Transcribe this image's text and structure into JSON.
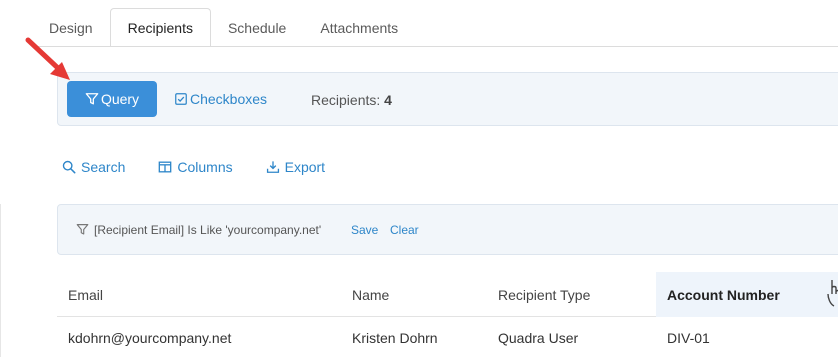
{
  "tabs": [
    {
      "label": "Design",
      "active": false
    },
    {
      "label": "Recipients",
      "active": true
    },
    {
      "label": "Schedule",
      "active": false
    },
    {
      "label": "Attachments",
      "active": false
    }
  ],
  "toolbar": {
    "query_label": "Query",
    "checkboxes_label": "Checkboxes",
    "recipients_label": "Recipients:",
    "recipients_count": "4"
  },
  "actions": {
    "search": "Search",
    "columns": "Columns",
    "export": "Export"
  },
  "filter": {
    "text": "[Recipient Email] Is Like 'yourcompany.net'",
    "save": "Save",
    "clear": "Clear"
  },
  "table": {
    "columns": [
      "Email",
      "Name",
      "Recipient Type",
      "Account Number"
    ],
    "sorted_column": "Account Number",
    "rows": [
      [
        "kdohrn@yourcompany.net",
        "Kristen Dohrn",
        "Quadra User",
        "DIV-01"
      ]
    ]
  },
  "colors": {
    "accent": "#3b8fd9",
    "link": "#2e86c9",
    "annotation_arrow": "#e53935",
    "panel_bg": "#f2f6fa"
  },
  "icons": {
    "query": "filter-icon",
    "checkboxes": "checkbox-icon",
    "search": "search-icon",
    "columns": "columns-icon",
    "export": "export-icon",
    "filter": "filter-icon"
  }
}
